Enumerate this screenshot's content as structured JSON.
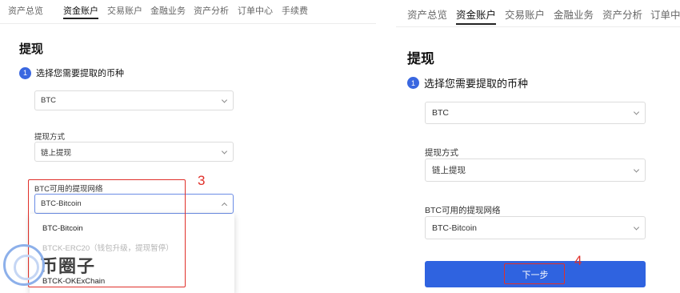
{
  "nav": {
    "tabs": [
      {
        "label": "资产总览"
      },
      {
        "label": "资金账户"
      },
      {
        "label": "交易账户"
      },
      {
        "label": "金融业务"
      },
      {
        "label": "资产分析"
      },
      {
        "label": "订单中心"
      },
      {
        "label": "手续费"
      }
    ],
    "right_tabs": [
      {
        "label": "资产总览"
      },
      {
        "label": "资金账户"
      },
      {
        "label": "交易账户"
      },
      {
        "label": "金融业务"
      },
      {
        "label": "资产分析"
      },
      {
        "label": "订单中心"
      }
    ],
    "active_tab": "资金账户"
  },
  "withdraw": {
    "title": "提现",
    "step_number": "1",
    "step_label": "选择您需要提取的币种",
    "currency_value": "BTC",
    "method_label": "提现方式",
    "method_value": "链上提现",
    "network_label": "BTC可用的提现网络",
    "network_value": "BTC-Bitcoin",
    "network_options": [
      {
        "label": "BTC-Bitcoin",
        "disabled": false
      },
      {
        "label": "BTCK-ERC20（钱包升级，提现暂停）",
        "disabled": true
      },
      {
        "label": "BTCK-OKExChain",
        "disabled": false
      }
    ],
    "next_button": "下一步"
  },
  "annotations": {
    "left_number": "3",
    "right_number": "4",
    "color": "#e0302a"
  },
  "watermark": {
    "text": "币圈子"
  },
  "colors": {
    "accent": "#2f63e0"
  }
}
